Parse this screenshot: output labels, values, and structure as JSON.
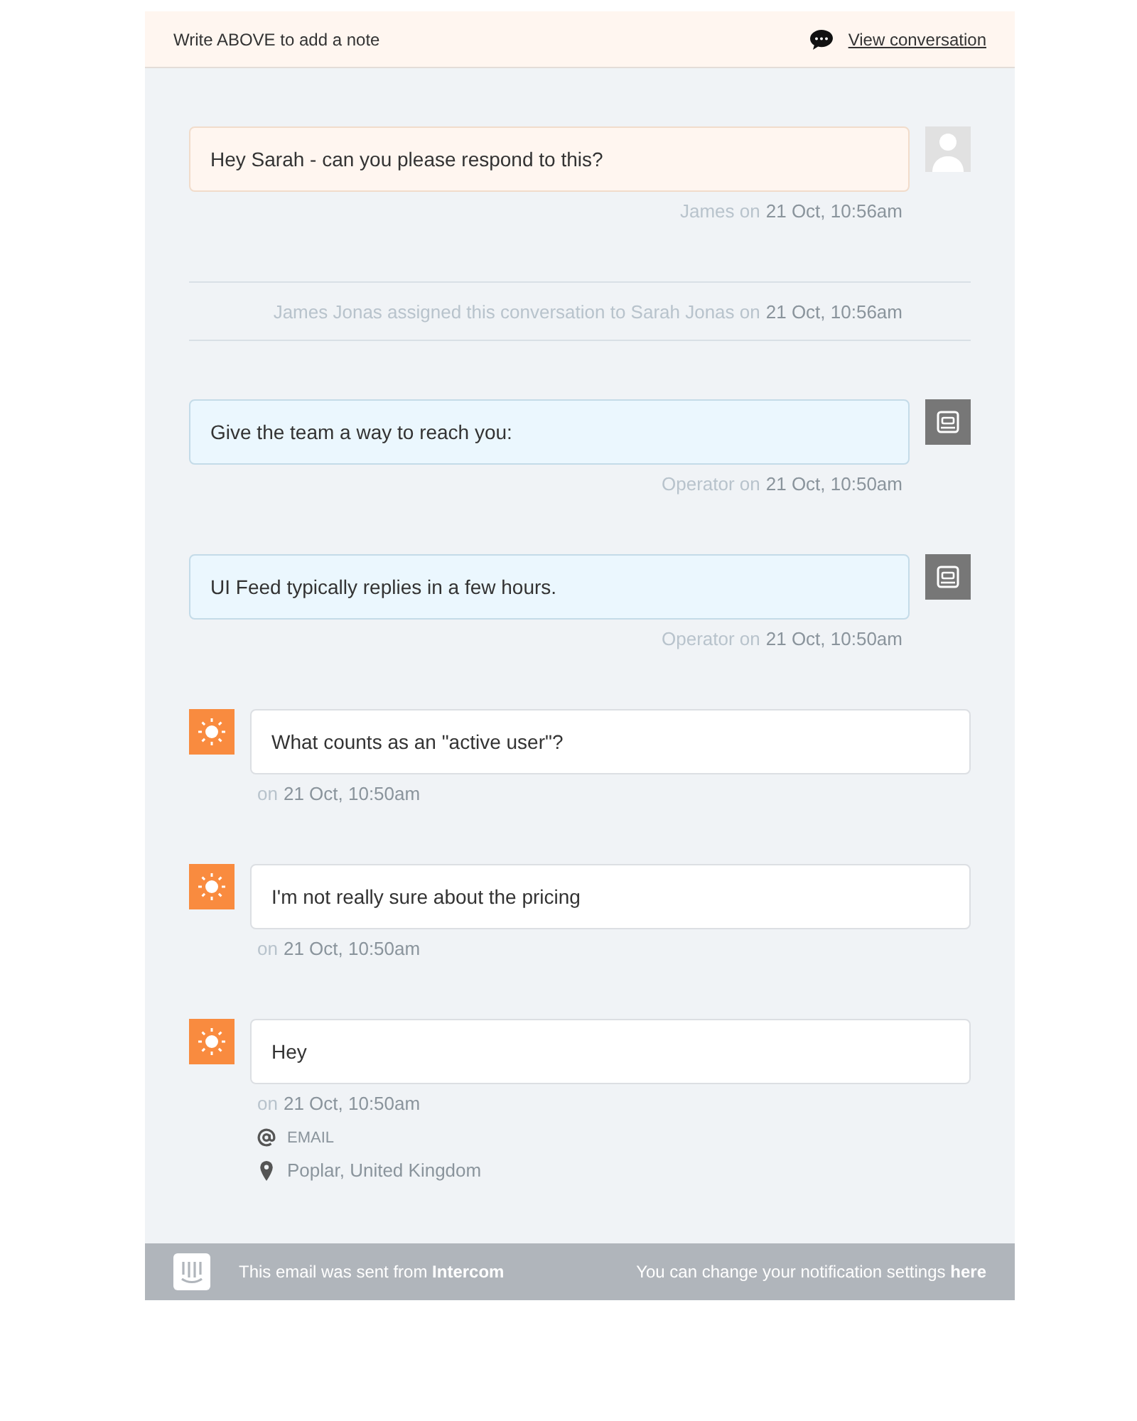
{
  "header": {
    "hint": "Write ABOVE to add a note",
    "link": "View conversation"
  },
  "items": [
    {
      "kind": "note",
      "text": "Hey Sarah - can you please respond to this?",
      "by": "James on",
      "date": "21 Oct, 10:56am"
    },
    {
      "kind": "event",
      "text": "James Jonas assigned this conversation to Sarah Jonas on",
      "date": "21 Oct, 10:56am"
    },
    {
      "kind": "operator",
      "text": "Give the team a way to reach you:",
      "by": "Operator on",
      "date": "21 Oct, 10:50am"
    },
    {
      "kind": "operator",
      "text": "UI Feed typically replies in a few hours.",
      "by": "Operator on",
      "date": "21 Oct, 10:50am"
    },
    {
      "kind": "user",
      "text": "What counts as an \"active user\"?",
      "by": "on",
      "date": "21 Oct, 10:50am"
    },
    {
      "kind": "user",
      "text": "I'm not really sure about the pricing",
      "by": "on",
      "date": "21 Oct, 10:50am"
    },
    {
      "kind": "user",
      "text": "Hey",
      "by": "on",
      "date": "21 Oct, 10:50am",
      "details": [
        {
          "kind": "email",
          "text": "EMAIL"
        },
        {
          "kind": "location",
          "text": "Poplar, United Kingdom"
        }
      ]
    }
  ],
  "footer": {
    "left": "This email was sent from **Intercom**",
    "right": "You can change your notification settings",
    "link": "here"
  }
}
